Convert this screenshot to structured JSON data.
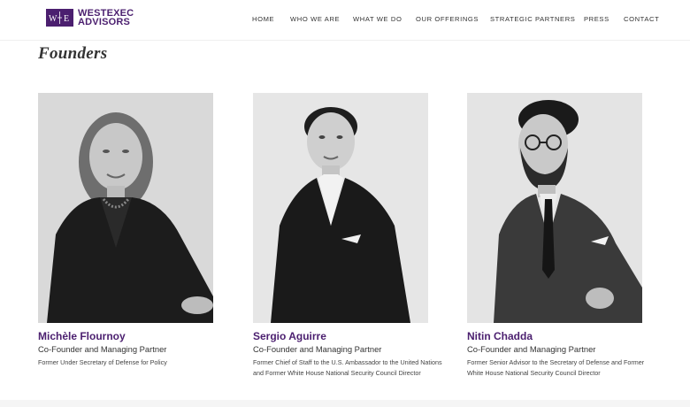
{
  "logo": {
    "line1": "WESTEXEC",
    "line2": "ADVISORS",
    "brand_color": "#4b1f6f"
  },
  "nav": {
    "items": [
      "HOME",
      "WHO WE ARE",
      "WHAT WE DO",
      "OUR OFFERINGS",
      "STRATEGIC PARTNERS",
      "PRESS",
      "CONTACT"
    ]
  },
  "section": {
    "title": "Founders"
  },
  "founders": [
    {
      "name": "Michèle Flournoy",
      "role": "Co-Founder and Managing Partner",
      "bio": "Former Under Secretary of Defense for Policy"
    },
    {
      "name": "Sergio Aguirre",
      "role": "Co-Founder and Managing Partner",
      "bio": "Former Chief of Staff to the U.S. Ambassador to the United Nations and Former White House National Security Council Director"
    },
    {
      "name": "Nitin Chadda",
      "role": "Co-Founder and Managing Partner",
      "bio": "Former Senior Advisor to the Secretary of Defense and Former White House National Security Council Director"
    }
  ]
}
